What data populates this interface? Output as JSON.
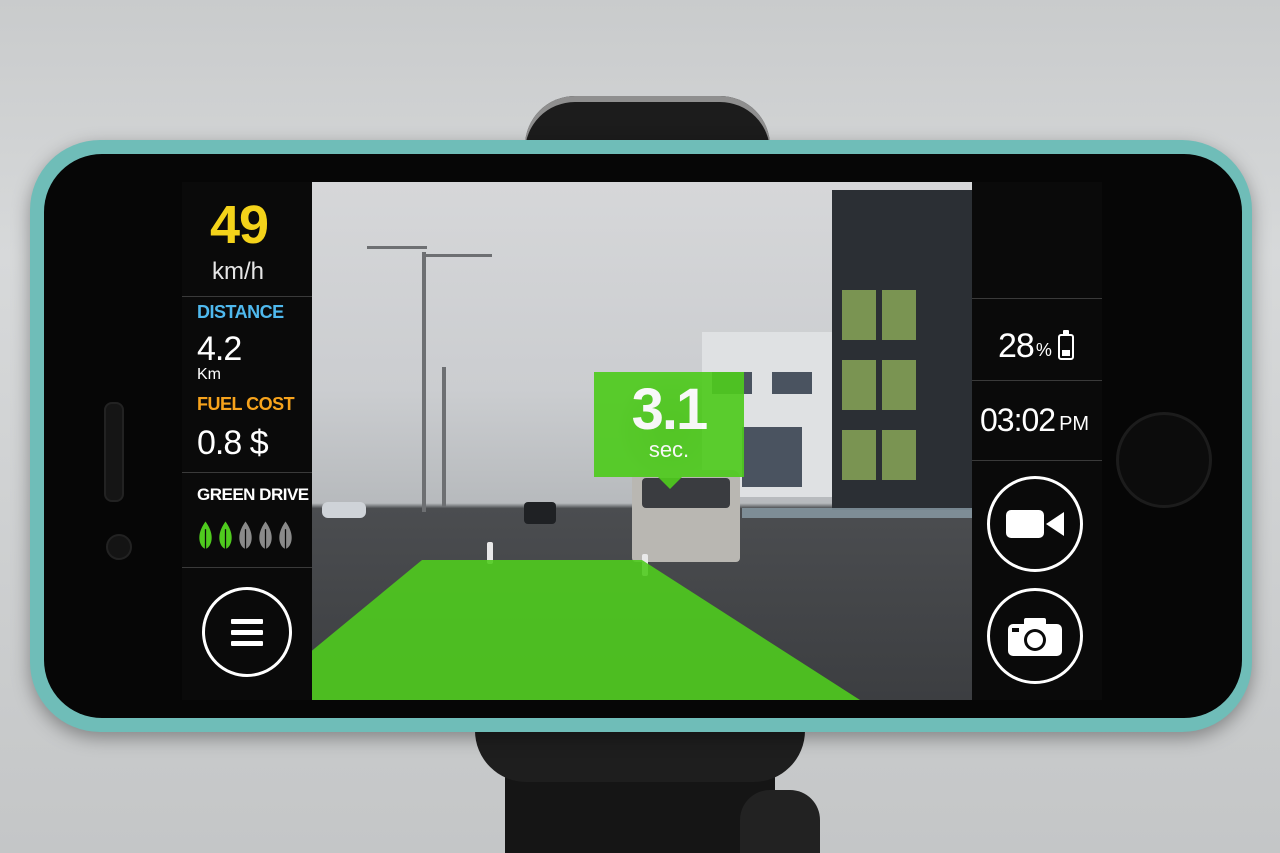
{
  "speed": {
    "value": "49",
    "unit": "km/h"
  },
  "distance": {
    "label": "DISTANCE",
    "value": "4.2",
    "unit": "Km"
  },
  "fuel_cost": {
    "label": "FUEL COST",
    "value": "0.8 $"
  },
  "green_drive": {
    "label": "GREEN DRIVE",
    "leaves_active": 2,
    "leaves_total": 5
  },
  "headway": {
    "value": "3.1",
    "unit": "sec."
  },
  "battery": {
    "value": "28",
    "unit": "%"
  },
  "clock": {
    "time": "03:02",
    "ampm": "PM"
  },
  "icons": {
    "menu": "hamburger-menu-icon",
    "video": "video-camera-icon",
    "photo": "photo-camera-icon",
    "battery": "battery-icon",
    "leaf": "leaf-icon"
  },
  "colors": {
    "speed": "#f4d31a",
    "distance_label": "#4fb9ee",
    "fuel_label": "#f7a31c",
    "lane_overlay": "#4fcb1e",
    "leaf_active": "#4fcb1e",
    "leaf_inactive": "#8a8a8a"
  }
}
